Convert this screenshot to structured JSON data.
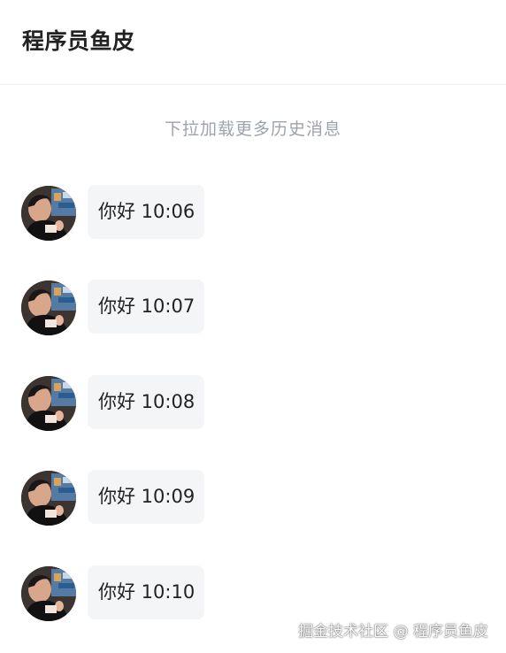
{
  "header": {
    "title": "程序员鱼皮"
  },
  "history": {
    "load_more_text": "下拉加载更多历史消息"
  },
  "messages": [
    {
      "text": "你好 10:06",
      "avatar_icon": "user-avatar-photo"
    },
    {
      "text": "你好 10:07",
      "avatar_icon": "user-avatar-photo"
    },
    {
      "text": "你好 10:08",
      "avatar_icon": "user-avatar-photo"
    },
    {
      "text": "你好 10:09",
      "avatar_icon": "user-avatar-photo"
    },
    {
      "text": "你好 10:10",
      "avatar_icon": "user-avatar-photo"
    }
  ],
  "watermark": {
    "text": "掘金技术社区 @ 程序员鱼皮"
  },
  "colors": {
    "background": "#ffffff",
    "bubble": "#f4f5f7",
    "primary_text": "#222222",
    "secondary_text": "#9ea3aa",
    "divider": "#eceef1"
  }
}
